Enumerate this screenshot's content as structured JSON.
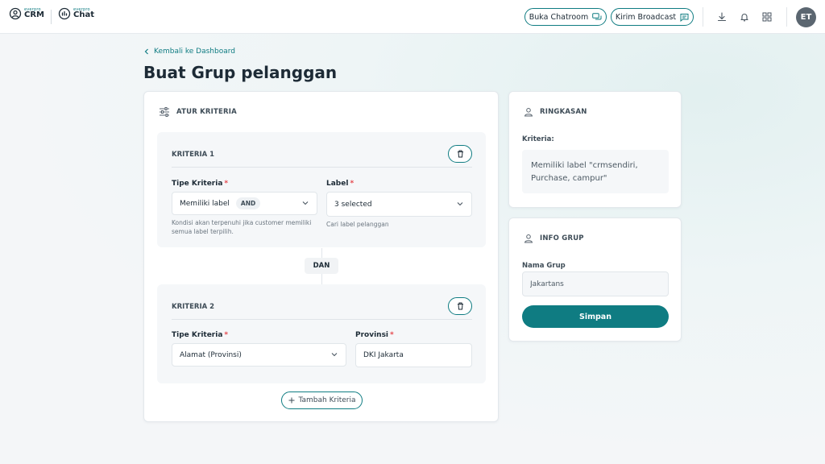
{
  "brand": {
    "crm_small": "everpro",
    "crm_name": "CRM",
    "chat_small": "everpro",
    "chat_name": "Chat"
  },
  "topbar": {
    "chatroom_label": "Buka Chatroom",
    "broadcast_label": "Kirim Broadcast",
    "avatar_initials": "ET"
  },
  "header": {
    "back_label": "Kembali ke Dashboard",
    "title": "Buat Grup pelanggan"
  },
  "criteria_card": {
    "title": "ATUR KRITERIA",
    "criteria": [
      {
        "title": "KRITERIA 1",
        "type_label": "Tipe Kriteria",
        "type_value": "Memiliki label",
        "type_badge": "AND",
        "type_help": "Kondisi akan terpenuhi jika customer memiliki semua label terpilih.",
        "second_label": "Label",
        "second_value": "3 selected",
        "second_help": "Cari label pelanggan"
      },
      {
        "title": "KRITERIA 2",
        "type_label": "Tipe Kriteria",
        "type_value": "Alamat (Provinsi)",
        "second_label": "Provinsi",
        "second_value": "DKI Jakarta"
      }
    ],
    "connector": "DAN",
    "add_label": "Tambah Kriteria"
  },
  "summary_card": {
    "title": "RINGKASAN",
    "label": "Kriteria:",
    "text": "Memiliki label \"crmsendiri, Purchase, campur\""
  },
  "info_card": {
    "title": "INFO GRUP",
    "name_label": "Nama Grup",
    "name_value": "Jakartans",
    "save_label": "Simpan"
  },
  "colors": {
    "accent": "#0f7c82",
    "required": "#e5484d"
  }
}
